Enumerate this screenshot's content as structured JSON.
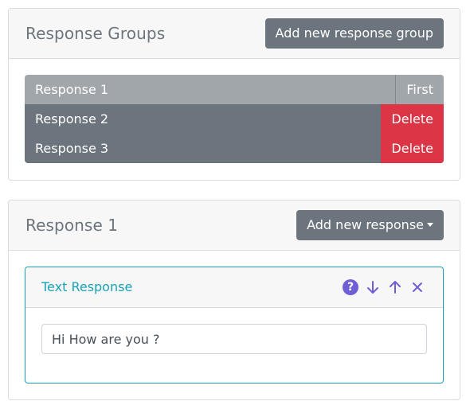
{
  "groups_card": {
    "title": "Response Groups",
    "add_button": "Add new response group",
    "items": [
      {
        "label": "Response 1",
        "action": "First"
      },
      {
        "label": "Response 2",
        "action": "Delete"
      },
      {
        "label": "Response 3",
        "action": "Delete"
      }
    ]
  },
  "response_card": {
    "title": "Response 1",
    "add_button": "Add new response",
    "text_response": {
      "title": "Text Response",
      "input_value": "Hi How are you ?",
      "icons": [
        "help-icon",
        "arrow-down-icon",
        "arrow-up-icon",
        "close-icon"
      ]
    }
  },
  "colors": {
    "accent": "#17a2b8",
    "secondary": "#6c757d",
    "danger": "#dc3545",
    "help": "#6f5fd6"
  }
}
